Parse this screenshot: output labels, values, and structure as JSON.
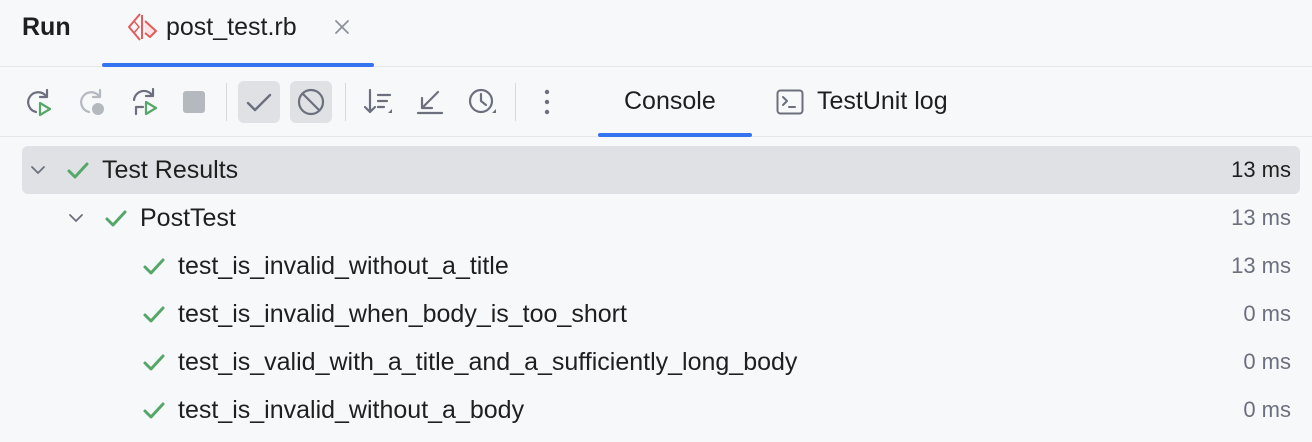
{
  "window": {
    "title": "Run",
    "tab": {
      "label": "post_test.rb",
      "icon": "ruby-test-icon",
      "close_icon": "close-icon"
    }
  },
  "toolbar": {
    "buttons": [
      {
        "name": "rerun-button",
        "icon": "rerun-icon",
        "state": "enabled"
      },
      {
        "name": "rerun-failed-button",
        "icon": "rerun-failed-icon",
        "state": "disabled"
      },
      {
        "name": "toggle-auto-test-button",
        "icon": "auto-rerun-icon",
        "state": "enabled"
      },
      {
        "name": "stop-button",
        "icon": "stop-icon",
        "state": "disabled"
      },
      {
        "name": "show-passed-button",
        "icon": "check-icon",
        "state": "toggled-on"
      },
      {
        "name": "show-ignored-button",
        "icon": "ignored-icon",
        "state": "toggled-on"
      },
      {
        "name": "sort-button",
        "icon": "sort-icon",
        "state": "enabled"
      },
      {
        "name": "collapse-all-button",
        "icon": "collapse-icon",
        "state": "enabled"
      },
      {
        "name": "history-button",
        "icon": "clock-icon",
        "state": "enabled"
      },
      {
        "name": "more-button",
        "icon": "more-vertical-icon",
        "state": "enabled"
      }
    ],
    "tabs": [
      {
        "label": "Console",
        "active": true
      },
      {
        "label": "TestUnit log",
        "icon": "terminal-icon",
        "active": false
      }
    ]
  },
  "results": {
    "root": {
      "label": "Test Results",
      "time": "13 ms",
      "status": "passed",
      "expanded": true
    },
    "suite": {
      "label": "PostTest",
      "time": "13 ms",
      "status": "passed",
      "expanded": true
    },
    "tests": [
      {
        "label": "test_is_invalid_without_a_title",
        "time": "13 ms",
        "status": "passed"
      },
      {
        "label": "test_is_invalid_when_body_is_too_short",
        "time": "0 ms",
        "status": "passed"
      },
      {
        "label": "test_is_valid_with_a_title_and_a_sufficiently_long_body",
        "time": "0 ms",
        "status": "passed"
      },
      {
        "label": "test_is_invalid_without_a_body",
        "time": "0 ms",
        "status": "passed"
      }
    ]
  },
  "colors": {
    "accent": "#3574f0",
    "passed": "#55a76a",
    "ruby": "#e55b5b",
    "icon": "#6c707e",
    "icon_disabled": "#b4b8bf",
    "background": "#f7f8fa",
    "selection": "#dfe1e5"
  }
}
